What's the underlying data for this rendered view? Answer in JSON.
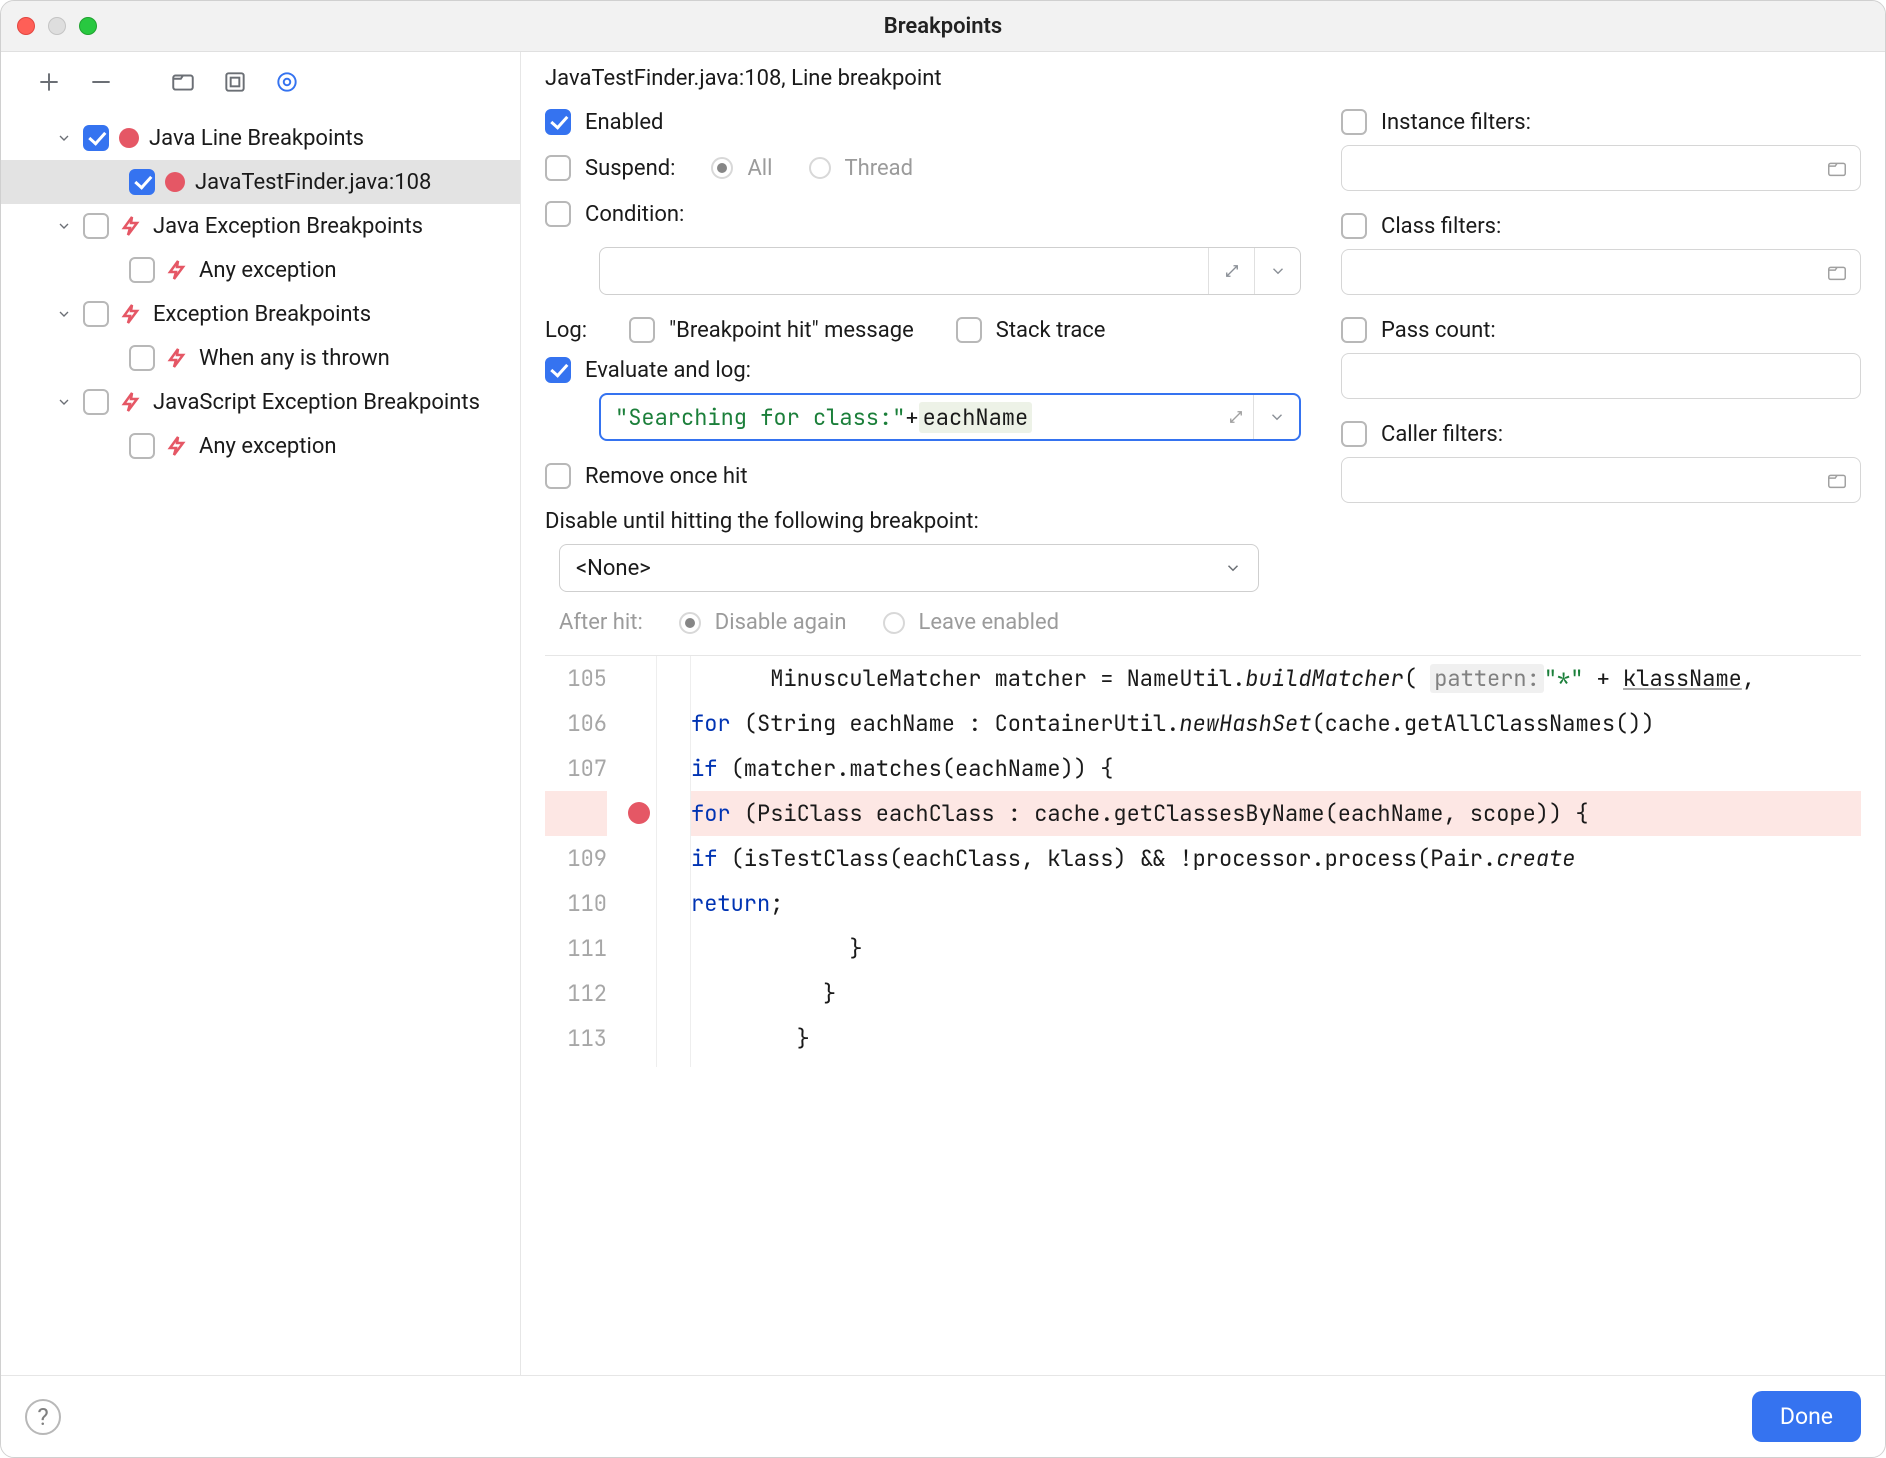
{
  "window": {
    "title": "Breakpoints"
  },
  "tree": {
    "groups": [
      {
        "label": "Java Line Breakpoints",
        "checked": true,
        "kind": "line",
        "children": [
          {
            "label": "JavaTestFinder.java:108",
            "checked": true,
            "selected": true
          }
        ]
      },
      {
        "label": "Java Exception Breakpoints",
        "checked": false,
        "kind": "exception",
        "children": [
          {
            "label": "Any exception",
            "checked": false
          }
        ]
      },
      {
        "label": "Exception Breakpoints",
        "checked": false,
        "kind": "exception",
        "children": [
          {
            "label": "When any is thrown",
            "checked": false
          }
        ]
      },
      {
        "label": "JavaScript Exception Breakpoints",
        "checked": false,
        "kind": "exception",
        "children": [
          {
            "label": "Any exception",
            "checked": false
          }
        ]
      }
    ]
  },
  "details": {
    "title": "JavaTestFinder.java:108, Line breakpoint",
    "enabled_label": "Enabled",
    "enabled": true,
    "suspend_label": "Suspend:",
    "suspend_checked": false,
    "suspend_all": "All",
    "suspend_thread": "Thread",
    "condition_label": "Condition:",
    "condition_checked": false,
    "log_label": "Log:",
    "log_bp_hit_label": "\"Breakpoint hit\" message",
    "log_bp_hit": false,
    "log_stack_label": "Stack trace",
    "log_stack": false,
    "eval_label": "Evaluate and log:",
    "eval_checked": true,
    "eval_expr_str": "\"Searching for class:\"",
    "eval_expr_op": " + ",
    "eval_expr_id": "eachName",
    "remove_once_label": "Remove once hit",
    "remove_once": false,
    "disable_until_label": "Disable until hitting the following breakpoint:",
    "disable_until_value": "<None>",
    "after_hit_label": "After hit:",
    "after_hit_disable": "Disable again",
    "after_hit_leave": "Leave enabled",
    "filters": {
      "instance_label": "Instance filters:",
      "class_label": "Class filters:",
      "pass_label": "Pass count:",
      "caller_label": "Caller filters:"
    }
  },
  "code": {
    "bp_line_index": 3,
    "lines": [
      {
        "num": "105",
        "indent": 3,
        "tokens": [
          {
            "t": "plain",
            "v": "MinusculeMatcher matcher = NameUtil."
          },
          {
            "t": "mth",
            "v": "buildMatcher"
          },
          {
            "t": "plain",
            "v": "( "
          },
          {
            "t": "hint",
            "v": "pattern:"
          },
          {
            "t": "plain",
            "v": " "
          },
          {
            "t": "str",
            "v": "\"*\""
          },
          {
            "t": "plain",
            "v": " + "
          },
          {
            "t": "und",
            "v": "klassName"
          },
          {
            "t": "plain",
            "v": ","
          }
        ]
      },
      {
        "num": "106",
        "indent": 3,
        "tokens": [
          {
            "t": "kw",
            "v": "for"
          },
          {
            "t": "plain",
            "v": " (String eachName : ContainerUtil."
          },
          {
            "t": "mth",
            "v": "newHashSet"
          },
          {
            "t": "plain",
            "v": "(cache.getAllClassNames())"
          }
        ]
      },
      {
        "num": "107",
        "indent": 4,
        "tokens": [
          {
            "t": "kw",
            "v": "if"
          },
          {
            "t": "plain",
            "v": " (matcher.matches(eachName)) {"
          }
        ]
      },
      {
        "num": "",
        "indent": 5,
        "tokens": [
          {
            "t": "kw",
            "v": "for"
          },
          {
            "t": "plain",
            "v": " (PsiClass eachClass : cache.getClassesByName(eachName, scope)) {"
          }
        ]
      },
      {
        "num": "109",
        "indent": 6,
        "tokens": [
          {
            "t": "kw",
            "v": "if"
          },
          {
            "t": "plain",
            "v": " (isTestClass(eachClass, klass) && !processor.process(Pair."
          },
          {
            "t": "mth",
            "v": "create"
          }
        ]
      },
      {
        "num": "110",
        "indent": 7,
        "tokens": [
          {
            "t": "kw",
            "v": "return"
          },
          {
            "t": "plain",
            "v": ";"
          }
        ]
      },
      {
        "num": "111",
        "indent": 6,
        "tokens": [
          {
            "t": "plain",
            "v": "}"
          }
        ]
      },
      {
        "num": "112",
        "indent": 5,
        "tokens": [
          {
            "t": "plain",
            "v": "}"
          }
        ]
      },
      {
        "num": "113",
        "indent": 4,
        "tokens": [
          {
            "t": "plain",
            "v": "}"
          }
        ]
      }
    ]
  },
  "footer": {
    "done": "Done"
  }
}
